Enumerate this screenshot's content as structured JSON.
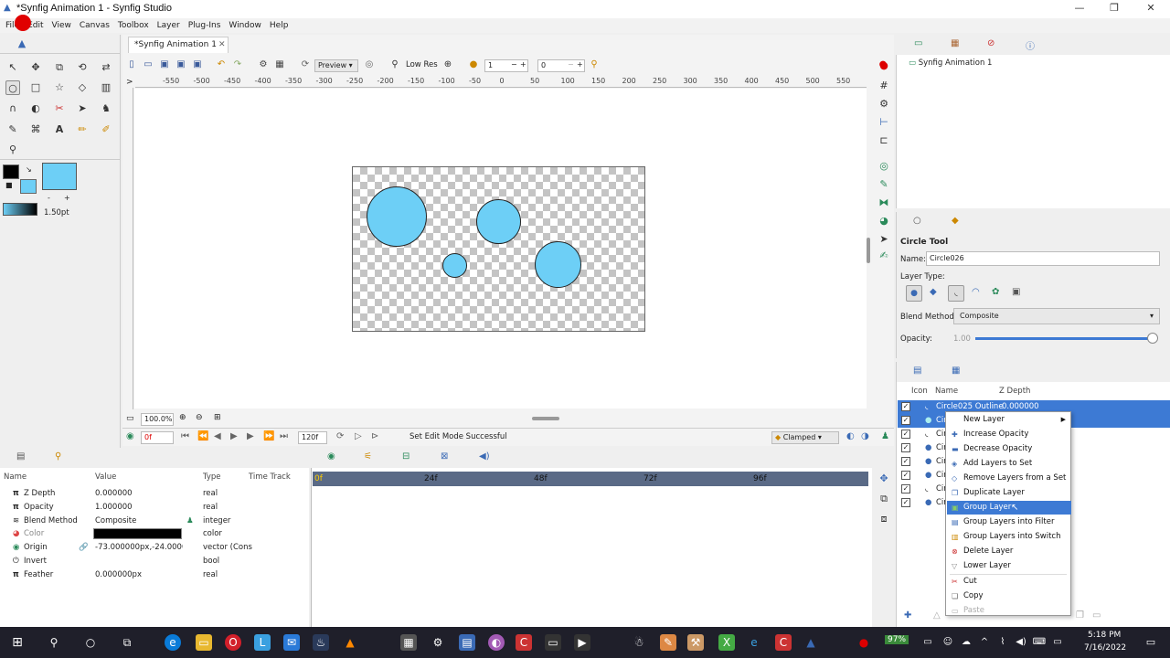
{
  "window": {
    "title": "*Synfig Animation 1 - Synfig Studio",
    "minimize": "—",
    "maximize": "❐",
    "close": "✕"
  },
  "menubar": [
    "File",
    "Edit",
    "View",
    "Canvas",
    "Toolbox",
    "Layer",
    "Plug-Ins",
    "Window",
    "Help"
  ],
  "toolbox": {
    "brush_size": "1.50pt"
  },
  "document": {
    "tab_label": "*Synfig Animation 1",
    "tab_close": "✕",
    "preview_label": "Preview",
    "lowres_label": "Low Res",
    "field_a": "1",
    "field_b": "0",
    "ruler_ticks": [
      "-550",
      "-500",
      "-450",
      "-400",
      "-350",
      "-300",
      "-250",
      "-200",
      "-150",
      "-100",
      "-50",
      "0",
      "50",
      "100",
      "150",
      "200",
      "250",
      "300",
      "350",
      "400",
      "450",
      "500",
      "550"
    ],
    "zoom": "100.0%",
    "current_frame": "0f",
    "end_frame": "120f",
    "status": "Set Edit Mode Successful",
    "interpolation": "Clamped"
  },
  "params": {
    "headers": {
      "name": "Name",
      "value": "Value",
      "type": "Type",
      "timetrack": "Time Track"
    },
    "rows": [
      {
        "name": "Z Depth",
        "value": "0.000000",
        "type": "real"
      },
      {
        "name": "Opacity",
        "value": "1.000000",
        "type": "real"
      },
      {
        "name": "Blend Method",
        "value": "Composite",
        "type": "integer"
      },
      {
        "name": "Color",
        "value": "",
        "type": "color"
      },
      {
        "name": "Origin",
        "value": "-73.000000px,-24.000000",
        "type": "vector (Cons"
      },
      {
        "name": "Invert",
        "value": "",
        "type": "bool"
      },
      {
        "name": "Feather",
        "value": "0.000000px",
        "type": "real"
      }
    ]
  },
  "timetrack": {
    "labels": [
      "0f",
      "24f",
      "48f",
      "72f",
      "96f"
    ]
  },
  "canvas_browser": {
    "item": "Synfig Animation 1"
  },
  "tool_options": {
    "title": "Circle Tool",
    "name_label": "Name:",
    "name_value": "Circle026",
    "layer_type_label": "Layer Type:",
    "blend_label": "Blend Method:",
    "blend_value": "Composite",
    "opacity_label": "Opacity:",
    "opacity_value": "1.00"
  },
  "layers": {
    "headers": {
      "icon": "Icon",
      "name": "Name",
      "zdepth": "Z Depth"
    },
    "rows": [
      {
        "name": "Circle025 Outline",
        "zdepth": "0.000000"
      },
      {
        "name": "Circ",
        "zdepth": ""
      },
      {
        "name": "Circ",
        "zdepth": ""
      },
      {
        "name": "Circ",
        "zdepth": ""
      },
      {
        "name": "Circ",
        "zdepth": ""
      },
      {
        "name": "Circ",
        "zdepth": ""
      },
      {
        "name": "Circ",
        "zdepth": ""
      },
      {
        "name": "Circ",
        "zdepth": ""
      }
    ]
  },
  "context_menu": {
    "items": [
      {
        "label": "New Layer",
        "icon": "",
        "arrow": "▶"
      },
      {
        "label": "Increase Opacity",
        "icon": "✚"
      },
      {
        "label": "Decrease Opacity",
        "icon": "▬"
      },
      {
        "label": "Add Layers to Set",
        "icon": "◈"
      },
      {
        "label": "Remove Layers from a Set",
        "icon": "◇"
      },
      {
        "label": "Duplicate Layer",
        "icon": "❐"
      },
      {
        "label": "Group Layer",
        "icon": "▣"
      },
      {
        "label": "Group Layers into Filter",
        "icon": "▤"
      },
      {
        "label": "Group Layers into Switch",
        "icon": "▥"
      },
      {
        "label": "Delete Layer",
        "icon": "⊗"
      },
      {
        "label": "Lower Layer",
        "icon": "▽"
      },
      {
        "label": "Cut",
        "icon": "✂"
      },
      {
        "label": "Copy",
        "icon": "❏"
      },
      {
        "label": "Paste",
        "icon": "▭"
      }
    ]
  },
  "taskbar": {
    "battery": "97%",
    "time": "5:18 PM",
    "date": "7/16/2022"
  }
}
